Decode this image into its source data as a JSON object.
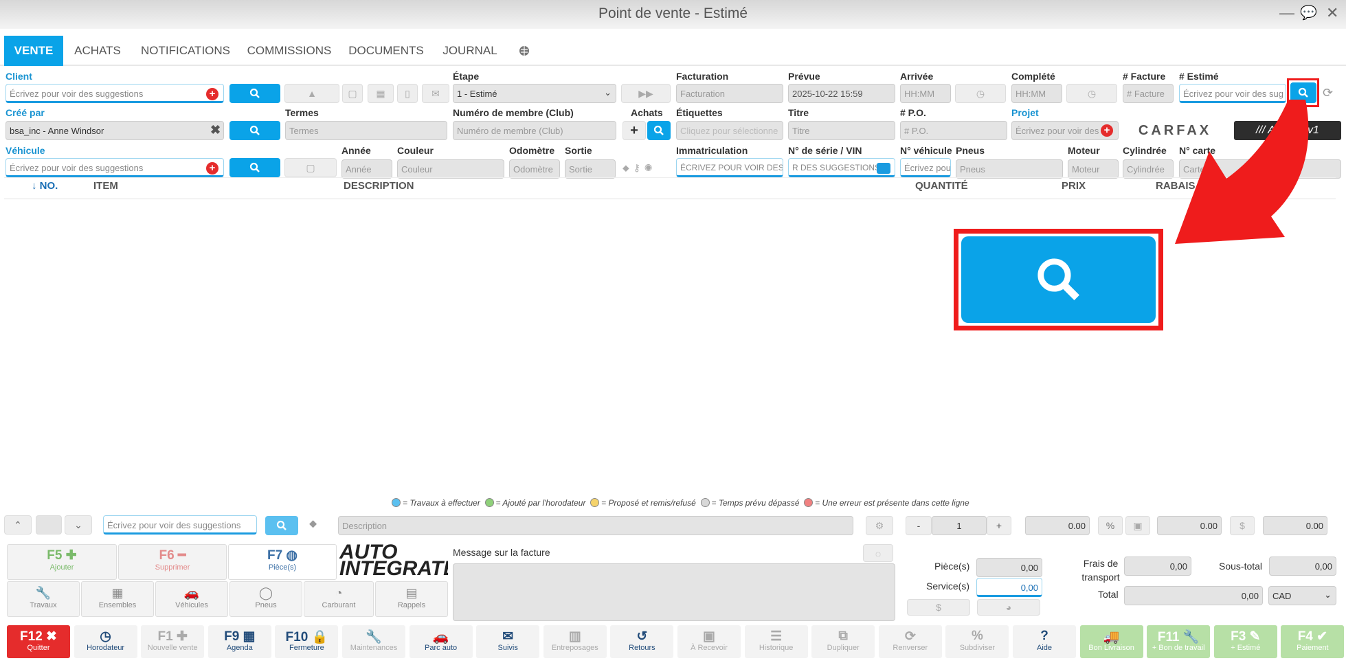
{
  "window": {
    "title": "Point de vente - Estimé",
    "minimize": "—",
    "chat": "💬",
    "close": "✕"
  },
  "tabs": [
    "VENTE",
    "ACHATS",
    "NOTIFICATIONS",
    "COMMISSIONS",
    "DOCUMENTS",
    "JOURNAL"
  ],
  "row1": {
    "client_label": "Client",
    "client_placeholder": "Écrivez pour voir des suggestions",
    "etape_label": "Étape",
    "etape_value": "1 - Estimé",
    "facturation_label": "Facturation",
    "facturation_placeholder": "Facturation",
    "prevue_label": "Prévue",
    "prevue_value": "2025-10-22 15:59",
    "arrivee_label": "Arrivée",
    "arrivee_placeholder": "HH:MM",
    "complete_label": "Complété",
    "complete_placeholder": "HH:MM",
    "facture_label": "# Facture",
    "facture_placeholder": "# Facture",
    "estime_label": "# Estimé",
    "estime_placeholder": "Écrivez pour voir des sug"
  },
  "row2": {
    "cree_label": "Créé par",
    "cree_value": "bsa_inc - Anne Windsor",
    "termes_label": "Termes",
    "termes_placeholder": "Termes",
    "membre_label": "Numéro de membre (Club)",
    "membre_placeholder": "Numéro de membre (Club)",
    "achats_label": "Achats",
    "etiquettes_label": "Étiquettes",
    "etiquettes_placeholder": "Cliquez pour sélectionne",
    "titre_label": "Titre",
    "titre_placeholder": "Titre",
    "po_label": "# P.O.",
    "po_placeholder": "# P.O.",
    "projet_label": "Projet",
    "projet_placeholder": "Écrivez pour voir des",
    "carfax": "CARFAX",
    "autoserv": "/// AutoServ1"
  },
  "row3": {
    "vehicule_label": "Véhicule",
    "vehicule_placeholder": "Écrivez pour voir des suggestions",
    "annee_label": "Année",
    "annee_placeholder": "Année",
    "couleur_label": "Couleur",
    "couleur_placeholder": "Couleur",
    "odometre_label": "Odomètre",
    "odometre_placeholder": "Odomètre",
    "sortie_label": "Sortie",
    "sortie_placeholder": "Sortie",
    "immat_label": "Immatriculation",
    "immat_placeholder": "ÉCRIVEZ POUR VOIR DES",
    "vin_label": "N° de série / VIN",
    "vin_placeholder": "R DES SUGGESTIONS",
    "nveh_label": "N° véhicule",
    "nveh_placeholder": "Écrivez pou",
    "pneus_label": "Pneus",
    "pneus_placeholder": "Pneus",
    "moteur_label": "Moteur",
    "moteur_placeholder": "Moteur",
    "cyl_label": "Cylindrée",
    "cyl_placeholder": "Cylindrée",
    "carte_label": "N° carte",
    "carte_placeholder": "Carte"
  },
  "columns": [
    "↓ NO.",
    "ITEM",
    "DESCRIPTION",
    "QUANTITÉ",
    "PRIX",
    "RABAIS ("
  ],
  "legend": [
    "= Travaux à effectuer",
    "= Ajouté par l'horodateur",
    "= Proposé et remis/refusé",
    "= Temps prévu dépassé",
    "= Une erreur est présente dans cette ligne"
  ],
  "legend_colors": [
    "#5bc0f0",
    "#8fd07a",
    "#f5d36b",
    "#d8d8d8",
    "#f08080"
  ],
  "lineedit": {
    "suggest_placeholder": "Écrivez pour voir des suggestions",
    "desc_placeholder": "Description",
    "qty": "1",
    "minus": "-",
    "plus": "+",
    "v1": "0.00",
    "pct": "%",
    "v2": "0.00",
    "dollar": "$",
    "v3": "0.00"
  },
  "fkeys": [
    {
      "k": "F5",
      "l": "Ajouter"
    },
    {
      "k": "F6",
      "l": "Supprimer"
    },
    {
      "k": "F7",
      "l": "Pièce(s)"
    }
  ],
  "tools": [
    "Travaux",
    "Ensembles",
    "Véhicules",
    "Pneus",
    "Carburant",
    "Rappels"
  ],
  "logo": "AUTO INTEGRATE",
  "message_label": "Message sur la facture",
  "totals": {
    "pieces_label": "Pièce(s)",
    "pieces": "0,00",
    "service_label": "Service(s)",
    "service": "0,00",
    "frais_label": "Frais de transport",
    "frais": "0,00",
    "sous_total_label": "Sous-total",
    "sous_total": "0,00",
    "total_label": "Total",
    "total": "0,00",
    "currency": "CAD"
  },
  "bottom": [
    {
      "k": "F12",
      "l": "Quitter"
    },
    {
      "k": "",
      "l": "Horodateur"
    },
    {
      "k": "F1",
      "l": "Nouvelle vente"
    },
    {
      "k": "F9",
      "l": "Agenda"
    },
    {
      "k": "F10",
      "l": "Fermeture"
    },
    {
      "k": "",
      "l": "Maintenances"
    },
    {
      "k": "",
      "l": "Parc auto"
    },
    {
      "k": "",
      "l": "Suivis"
    },
    {
      "k": "",
      "l": "Entreposages"
    },
    {
      "k": "",
      "l": "Retours"
    },
    {
      "k": "",
      "l": "À Recevoir"
    },
    {
      "k": "",
      "l": "Historique"
    },
    {
      "k": "",
      "l": "Dupliquer"
    },
    {
      "k": "",
      "l": "Renverser"
    },
    {
      "k": "",
      "l": "Subdiviser"
    },
    {
      "k": "?",
      "l": "Aide"
    },
    {
      "k": "",
      "l": "Bon Livraison"
    },
    {
      "k": "F11",
      "l": "+ Bon de travail"
    },
    {
      "k": "F3",
      "l": "+ Estimé"
    },
    {
      "k": "F4",
      "l": "Paiement"
    }
  ],
  "colors": {
    "accent": "#0aa3e8",
    "danger": "#e52c2c",
    "highlight": "#ef1c1c",
    "success": "#8fd07a"
  }
}
